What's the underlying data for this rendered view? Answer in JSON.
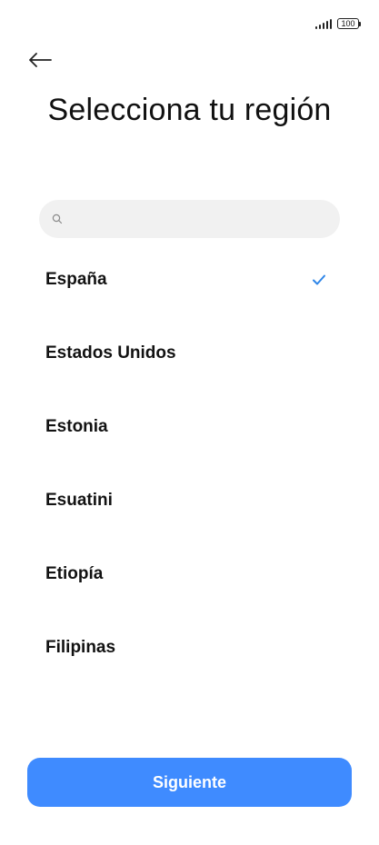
{
  "status_bar": {
    "battery_level": "100",
    "signal_icon": "signal-bars-icon"
  },
  "header": {
    "back_icon": "arrow-left-icon",
    "title": "Selecciona tu región"
  },
  "search": {
    "placeholder": "",
    "value": "",
    "icon": "search-icon"
  },
  "regions": [
    {
      "label": "España",
      "selected": true
    },
    {
      "label": "Estados Unidos",
      "selected": false
    },
    {
      "label": "Estonia",
      "selected": false
    },
    {
      "label": "Esuatini",
      "selected": false
    },
    {
      "label": "Etiopía",
      "selected": false
    },
    {
      "label": "Filipinas",
      "selected": false
    }
  ],
  "colors": {
    "accent": "#3f8bff",
    "check": "#2f86e8",
    "search_bg": "#f1f1f1"
  },
  "footer": {
    "next_label": "Siguiente"
  }
}
